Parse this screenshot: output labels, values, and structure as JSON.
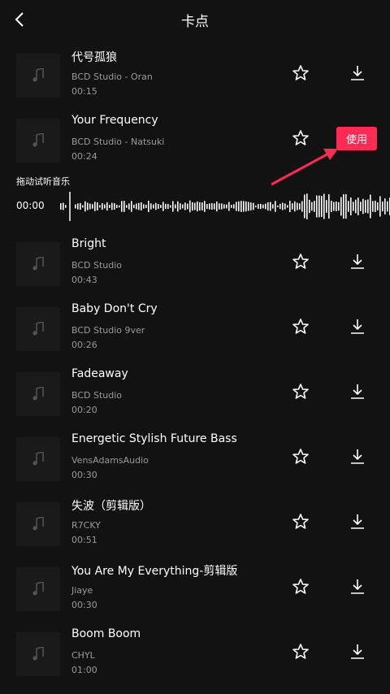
{
  "header": {
    "title": "卡点"
  },
  "songs": [
    {
      "name": "代号孤狼",
      "artist": "BCD Studio - Oran",
      "duration": "00:15"
    },
    {
      "name": "Your Frequency",
      "artist": "BCD Studio - Natsuki",
      "duration": "00:24"
    },
    {
      "name": "Bright",
      "artist": "BCD Studio",
      "duration": "00:43"
    },
    {
      "name": "Baby Don't Cry",
      "artist": "BCD Studio 9ver",
      "duration": "00:26"
    },
    {
      "name": "Fadeaway",
      "artist": "BCD Studio",
      "duration": "00:20"
    },
    {
      "name": "Energetic Stylish Future Bass",
      "artist": "VensAdamsAudio",
      "duration": "00:30"
    },
    {
      "name": "失波（剪辑版）",
      "artist": "R7CKY",
      "duration": "00:51"
    },
    {
      "name": "You Are My Everything-剪辑版",
      "artist": "Jiaye",
      "duration": "00:30"
    },
    {
      "name": "Boom Boom",
      "artist": "CHYL",
      "duration": "01:00"
    }
  ],
  "player": {
    "hint": "拖动试听音乐",
    "current_time": "00:00",
    "use_label": "使用"
  },
  "colors": {
    "accent": "#fe2c55",
    "background": "#121212",
    "secondary_text": "#9a9a9a"
  },
  "icons": {
    "back": "chevron-left-icon",
    "favorite": "star-icon",
    "download": "download-icon",
    "cover": "music-note-icon",
    "pointer": "red-arrow"
  }
}
